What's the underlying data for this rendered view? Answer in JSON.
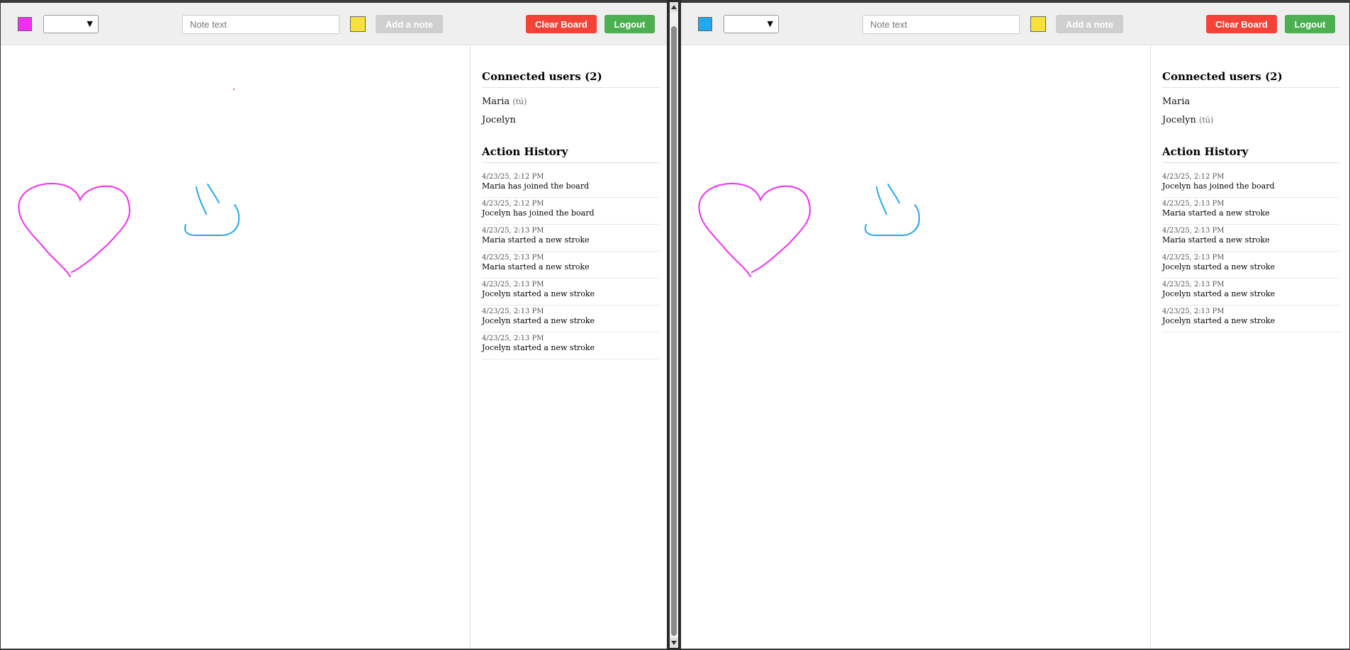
{
  "colors": {
    "magenta": "#f22ef2",
    "blue": "#1fa9f1",
    "note_yellow": "#f7e23c",
    "clear_red": "#f44336",
    "logout_green": "#4caf50"
  },
  "left": {
    "toolbar": {
      "pen_color": "#f22ef2",
      "note_placeholder": "Note text",
      "add_note_label": "Add a note",
      "clear_label": "Clear Board",
      "logout_label": "Logout"
    },
    "users_title": "Connected users (2)",
    "users": [
      {
        "name": "Maria",
        "tag": "(tú)"
      },
      {
        "name": "Jocelyn",
        "tag": ""
      }
    ],
    "history_title": "Action History",
    "history": [
      {
        "ts": "4/23/25, 2:12 PM",
        "msg": "Maria has joined the board"
      },
      {
        "ts": "4/23/25, 2:12 PM",
        "msg": "Jocelyn has joined the board"
      },
      {
        "ts": "4/23/25, 2:13 PM",
        "msg": "Maria started a new stroke"
      },
      {
        "ts": "4/23/25, 2:13 PM",
        "msg": "Maria started a new stroke"
      },
      {
        "ts": "4/23/25, 2:13 PM",
        "msg": "Jocelyn started a new stroke"
      },
      {
        "ts": "4/23/25, 2:13 PM",
        "msg": "Jocelyn started a new stroke"
      },
      {
        "ts": "4/23/25, 2:13 PM",
        "msg": "Jocelyn started a new stroke"
      }
    ]
  },
  "right": {
    "toolbar": {
      "pen_color": "#1fa9f1",
      "note_placeholder": "Note text",
      "add_note_label": "Add a note",
      "clear_label": "Clear Board",
      "logout_label": "Logout"
    },
    "users_title": "Connected users (2)",
    "users": [
      {
        "name": "Maria",
        "tag": ""
      },
      {
        "name": "Jocelyn",
        "tag": "(tú)"
      }
    ],
    "history_title": "Action History",
    "history": [
      {
        "ts": "4/23/25, 2:12 PM",
        "msg": "Jocelyn has joined the board"
      },
      {
        "ts": "4/23/25, 2:13 PM",
        "msg": "Maria started a new stroke"
      },
      {
        "ts": "4/23/25, 2:13 PM",
        "msg": "Maria started a new stroke"
      },
      {
        "ts": "4/23/25, 2:13 PM",
        "msg": "Jocelyn started a new stroke"
      },
      {
        "ts": "4/23/25, 2:13 PM",
        "msg": "Jocelyn started a new stroke"
      },
      {
        "ts": "4/23/25, 2:13 PM",
        "msg": "Jocelyn started a new stroke"
      }
    ]
  }
}
